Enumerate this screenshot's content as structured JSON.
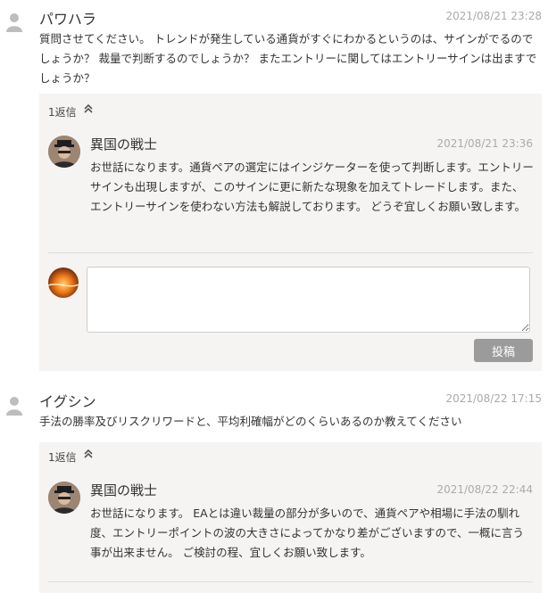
{
  "comments": [
    {
      "author": "パワハラ",
      "date": "2021/08/21 23:28",
      "text": "質問させてください。 トレンドが発生している通貨がすぐにわかるというのは、サインがでるのでしょうか？ 裁量で判断するのでしょうか？ またエントリーに関してはエントリーサインは出ますでしょうか？",
      "replies_label": "1返信",
      "reply": {
        "author": "異国の戦士",
        "date": "2021/08/21 23:36",
        "text": "お世話になります。通貨ペアの選定にはインジケーターを使って判断します。エントリーサインも出現しますが、このサインに更に新たな現象を加えてトレードします。また、エントリーサインを使わない方法も解説しております。 どうぞ宜しくお願い致します。"
      },
      "reply_form": {
        "textarea_value": "",
        "post_label": "投稿"
      }
    },
    {
      "author": "イグシン",
      "date": "2021/08/22 17:15",
      "text": "手法の勝率及びリスクリワードと、平均利確幅がどのくらいあるのか教えてください",
      "replies_label": "1返信",
      "reply": {
        "author": "異国の戦士",
        "date": "2021/08/22 22:44",
        "text": "お世話になります。 EAとは違い裁量の部分が多いので、通貨ペアや相場に手法の馴れ度、エントリーポイントの波の大きさによってかなり差がございますので、一概に言う事が出来ません。 ご検討の程、宜しくお願い致します。"
      }
    }
  ],
  "icons": {
    "collapse": "double-chevron-up-icon",
    "user": "user-silhouette-icon"
  }
}
